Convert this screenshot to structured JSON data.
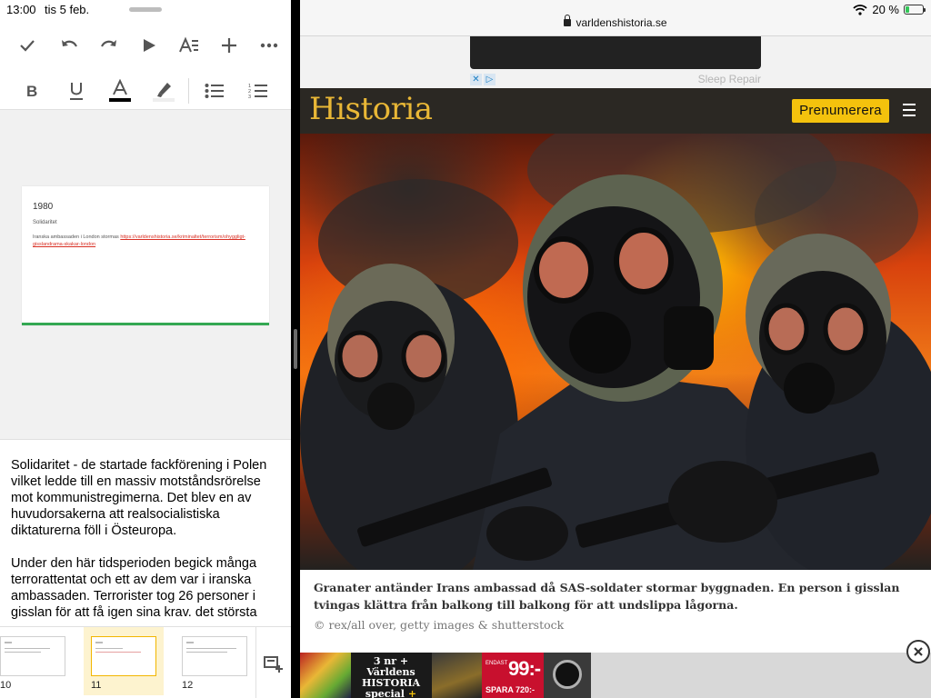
{
  "left_status": {
    "time": "13:00",
    "date": "tis 5 feb."
  },
  "toolbar_primary": [
    "check-icon",
    "undo-icon",
    "redo-icon",
    "play-icon",
    "text-format-icon",
    "add-icon",
    "more-icon"
  ],
  "toolbar_secondary": [
    "bold-icon",
    "underline-icon",
    "text-color-icon",
    "highlight-icon",
    "bulleted-list-icon",
    "numbered-list-icon"
  ],
  "colors": {
    "text_color_swatch": "#000000",
    "slide_accent": "#34a853",
    "thumb_selected": "#fdf3cf",
    "thumb_selected_border": "#f2b600",
    "subscribe_button": "#f4c20d",
    "logo": "#e9b736",
    "header_bg": "#2b2823"
  },
  "slide": {
    "title": "1980",
    "subtitle": "Solidaritet",
    "body_prefix": "Iranska ambassaden i London stormas ",
    "body_link": "https://varldenshistoria.se/kriminaltet/terrorism/ohyggligt-gisslandrama-skakar-london"
  },
  "notes": {
    "paragraph1": "Solidaritet - de startade fackförening i Polen vilket ledde till en massiv motståndsrörelse mot kommunistregimerna. Det blev en av huvudorsakerna att realsocialistiska diktaturerna föll i Östeuropa.",
    "paragraph2": "Under den här tidsperioden begick många terrorattentat och ett av dem var i iranska ambassaden. Terrorister tog 26 personer i gisslan för att få igen sina krav. det största"
  },
  "filmstrip": [
    {
      "num": "10",
      "selected": false
    },
    {
      "num": "11",
      "selected": true
    },
    {
      "num": "12",
      "selected": false
    }
  ],
  "browser": {
    "url": "varldenshistoria.se",
    "battery_text": "20 %",
    "battery_level": 0.2
  },
  "ad_top": {
    "label": "Sleep Repair"
  },
  "site": {
    "logo": "Historia",
    "subscribe_label": "Prenumerera"
  },
  "article": {
    "caption": "Granater antänder Irans ambassad då SAS-soldater stormar byggnaden. En person i gisslan tvingas klättra från balkong till balkong för att undslippa lågorna.",
    "credit": "© rex/all over, getty images & shutterstock"
  },
  "ad_bottom": {
    "line1": "3 nr + Världens",
    "line2": "HISTORIA",
    "line3_a": "special",
    "line3_b": "+ Klocka",
    "price_prefix": "ENDAST",
    "price": "99:-",
    "save": "SPARA 720:-"
  }
}
